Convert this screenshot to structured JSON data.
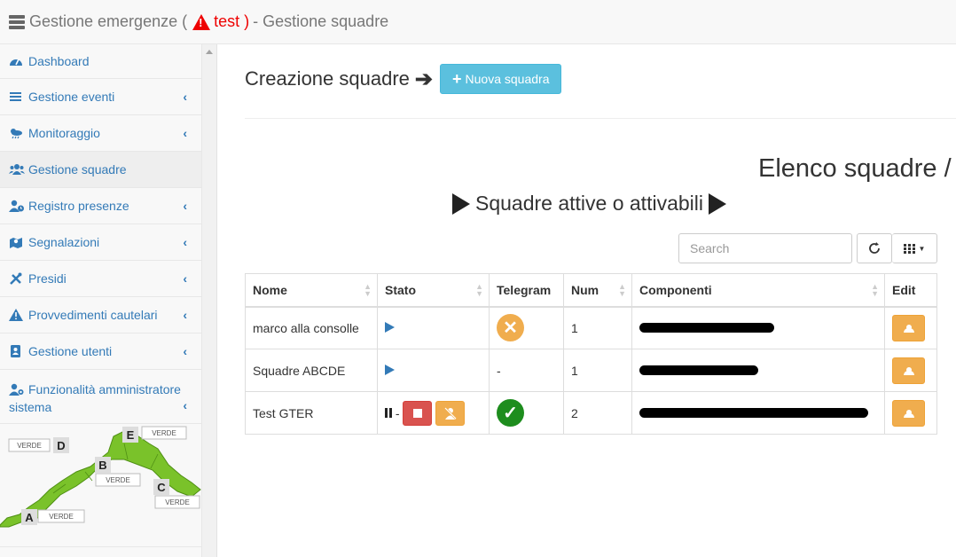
{
  "header": {
    "app_title": "Gestione emergenze (",
    "env_label": "test",
    "close_paren": ")",
    "page_title": "- Gestione squadre"
  },
  "sidebar": {
    "items": [
      {
        "label": "Dashboard",
        "icon": "dashboard-icon"
      },
      {
        "label": "Gestione eventi",
        "icon": "list-icon"
      },
      {
        "label": "Monitoraggio",
        "icon": "weather-icon"
      },
      {
        "label": "Gestione squadre",
        "icon": "users-icon"
      },
      {
        "label": "Registro presenze",
        "icon": "user-clock-icon"
      },
      {
        "label": "Segnalazioni",
        "icon": "map-marker-icon"
      },
      {
        "label": "Presidi",
        "icon": "tools-icon"
      },
      {
        "label": "Provvedimenti cautelari",
        "icon": "warning-icon"
      },
      {
        "label": "Gestione utenti",
        "icon": "address-book-icon"
      },
      {
        "label": "Funzionalità amministratore sistema",
        "icon": "user-cog-icon"
      }
    ]
  },
  "map": {
    "zones": [
      {
        "letter": "A",
        "status": "VERDE"
      },
      {
        "letter": "B",
        "status": "VERDE"
      },
      {
        "letter": "C",
        "status": "VERDE"
      },
      {
        "letter": "D",
        "status": "VERDE"
      },
      {
        "letter": "E",
        "status": "VERDE"
      }
    ],
    "color": "#7ac22a"
  },
  "main": {
    "creazione_title": "Creazione squadre",
    "new_button": "Nuova squadra",
    "elenco_title": "Elenco squadre /",
    "attive_title": "Squadre attive o attivabili",
    "search_placeholder": "Search"
  },
  "table": {
    "headers": [
      "Nome",
      "Stato",
      "Telegram",
      "Num",
      "Componenti",
      "Edit"
    ],
    "rows": [
      {
        "nome": "marco alla consolle",
        "num": "1",
        "telegram": "no"
      },
      {
        "nome": "Squadre ABCDE",
        "num": "1",
        "telegram": "-"
      },
      {
        "nome": "Test GTER",
        "num": "2",
        "telegram": "ok"
      }
    ],
    "stato_separator": "-"
  },
  "colors": {
    "primary": "#337ab7",
    "info": "#5bc0de",
    "warning": "#f0ad4e",
    "danger": "#d9534f",
    "success": "#1e8d1e",
    "alert_red": "#e00"
  }
}
